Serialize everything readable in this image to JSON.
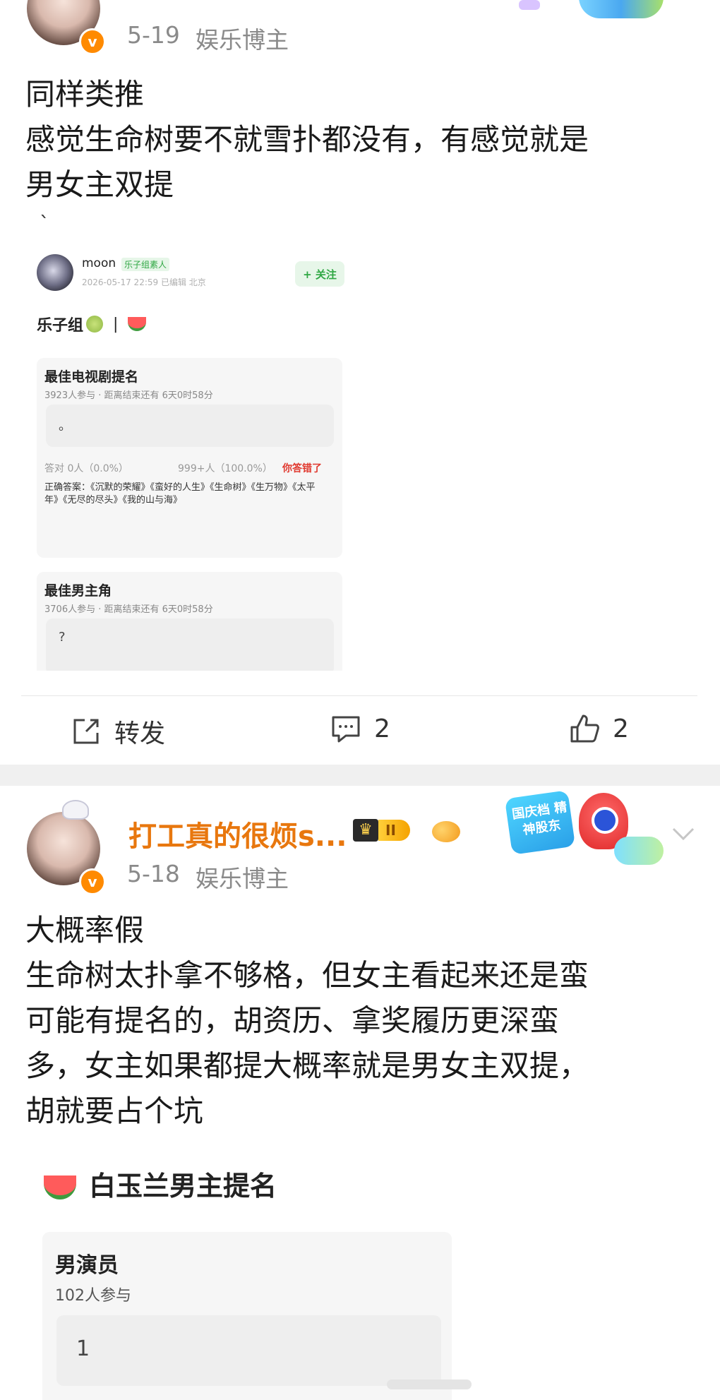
{
  "post1": {
    "date": "5-19",
    "source": "娱乐博主",
    "lines": [
      "同样类推",
      "感觉生命树要不就雪扑都没有，有感觉就是",
      "男女主双提"
    ],
    "tick": "`",
    "embed": {
      "username": "moon",
      "user_tag": "乐子组素人",
      "timestamp": "2026-05-17 22:59  已编辑  北京",
      "follow": "+ 关注",
      "group_title": "乐子组",
      "group_sep": "|",
      "q1": {
        "title": "最佳电视剧提名",
        "participants": "3923人参与 · 距离结束还有 6天0时58分",
        "answer": "。",
        "stat_correct": "答对  0人（0.0%）",
        "stat_wrong": "999+人（100.0%）",
        "wrong_label": "你答错了",
        "correct_answer": "正确答案：《沉默的荣耀》《蛮好的人生》《生命树》《生万物》《太平年》《无尽的尽头》《我的山与海》"
      },
      "q2": {
        "title": "最佳男主角",
        "participants": "3706人参与 · 距离结束还有 6天0时58分",
        "answer": "?"
      }
    },
    "actions": {
      "repost": "转发",
      "comments": "2",
      "likes": "2"
    }
  },
  "post2": {
    "username": "打工真的很烦s...",
    "level": "II",
    "date": "5-18",
    "source": "娱乐博主",
    "banner_text": "国庆档 精神股东",
    "lines": [
      "大概率假",
      "生命树太扑拿不够格，但女主看起来还是蛮",
      "可能有提名的，胡资历、拿奖履历更深蛮",
      "多，女主如果都提大概率就是男女主双提，",
      "胡就要占个坑"
    ],
    "embed": {
      "title": "白玉兰男主提名",
      "card_title": "男演员",
      "participants": "102人参与",
      "answer": "1"
    }
  },
  "colors": {
    "accent_orange": "#ff8200",
    "name_orange": "#e8770e",
    "follow_green": "#2fa743",
    "wrong_red": "#e0382e"
  }
}
